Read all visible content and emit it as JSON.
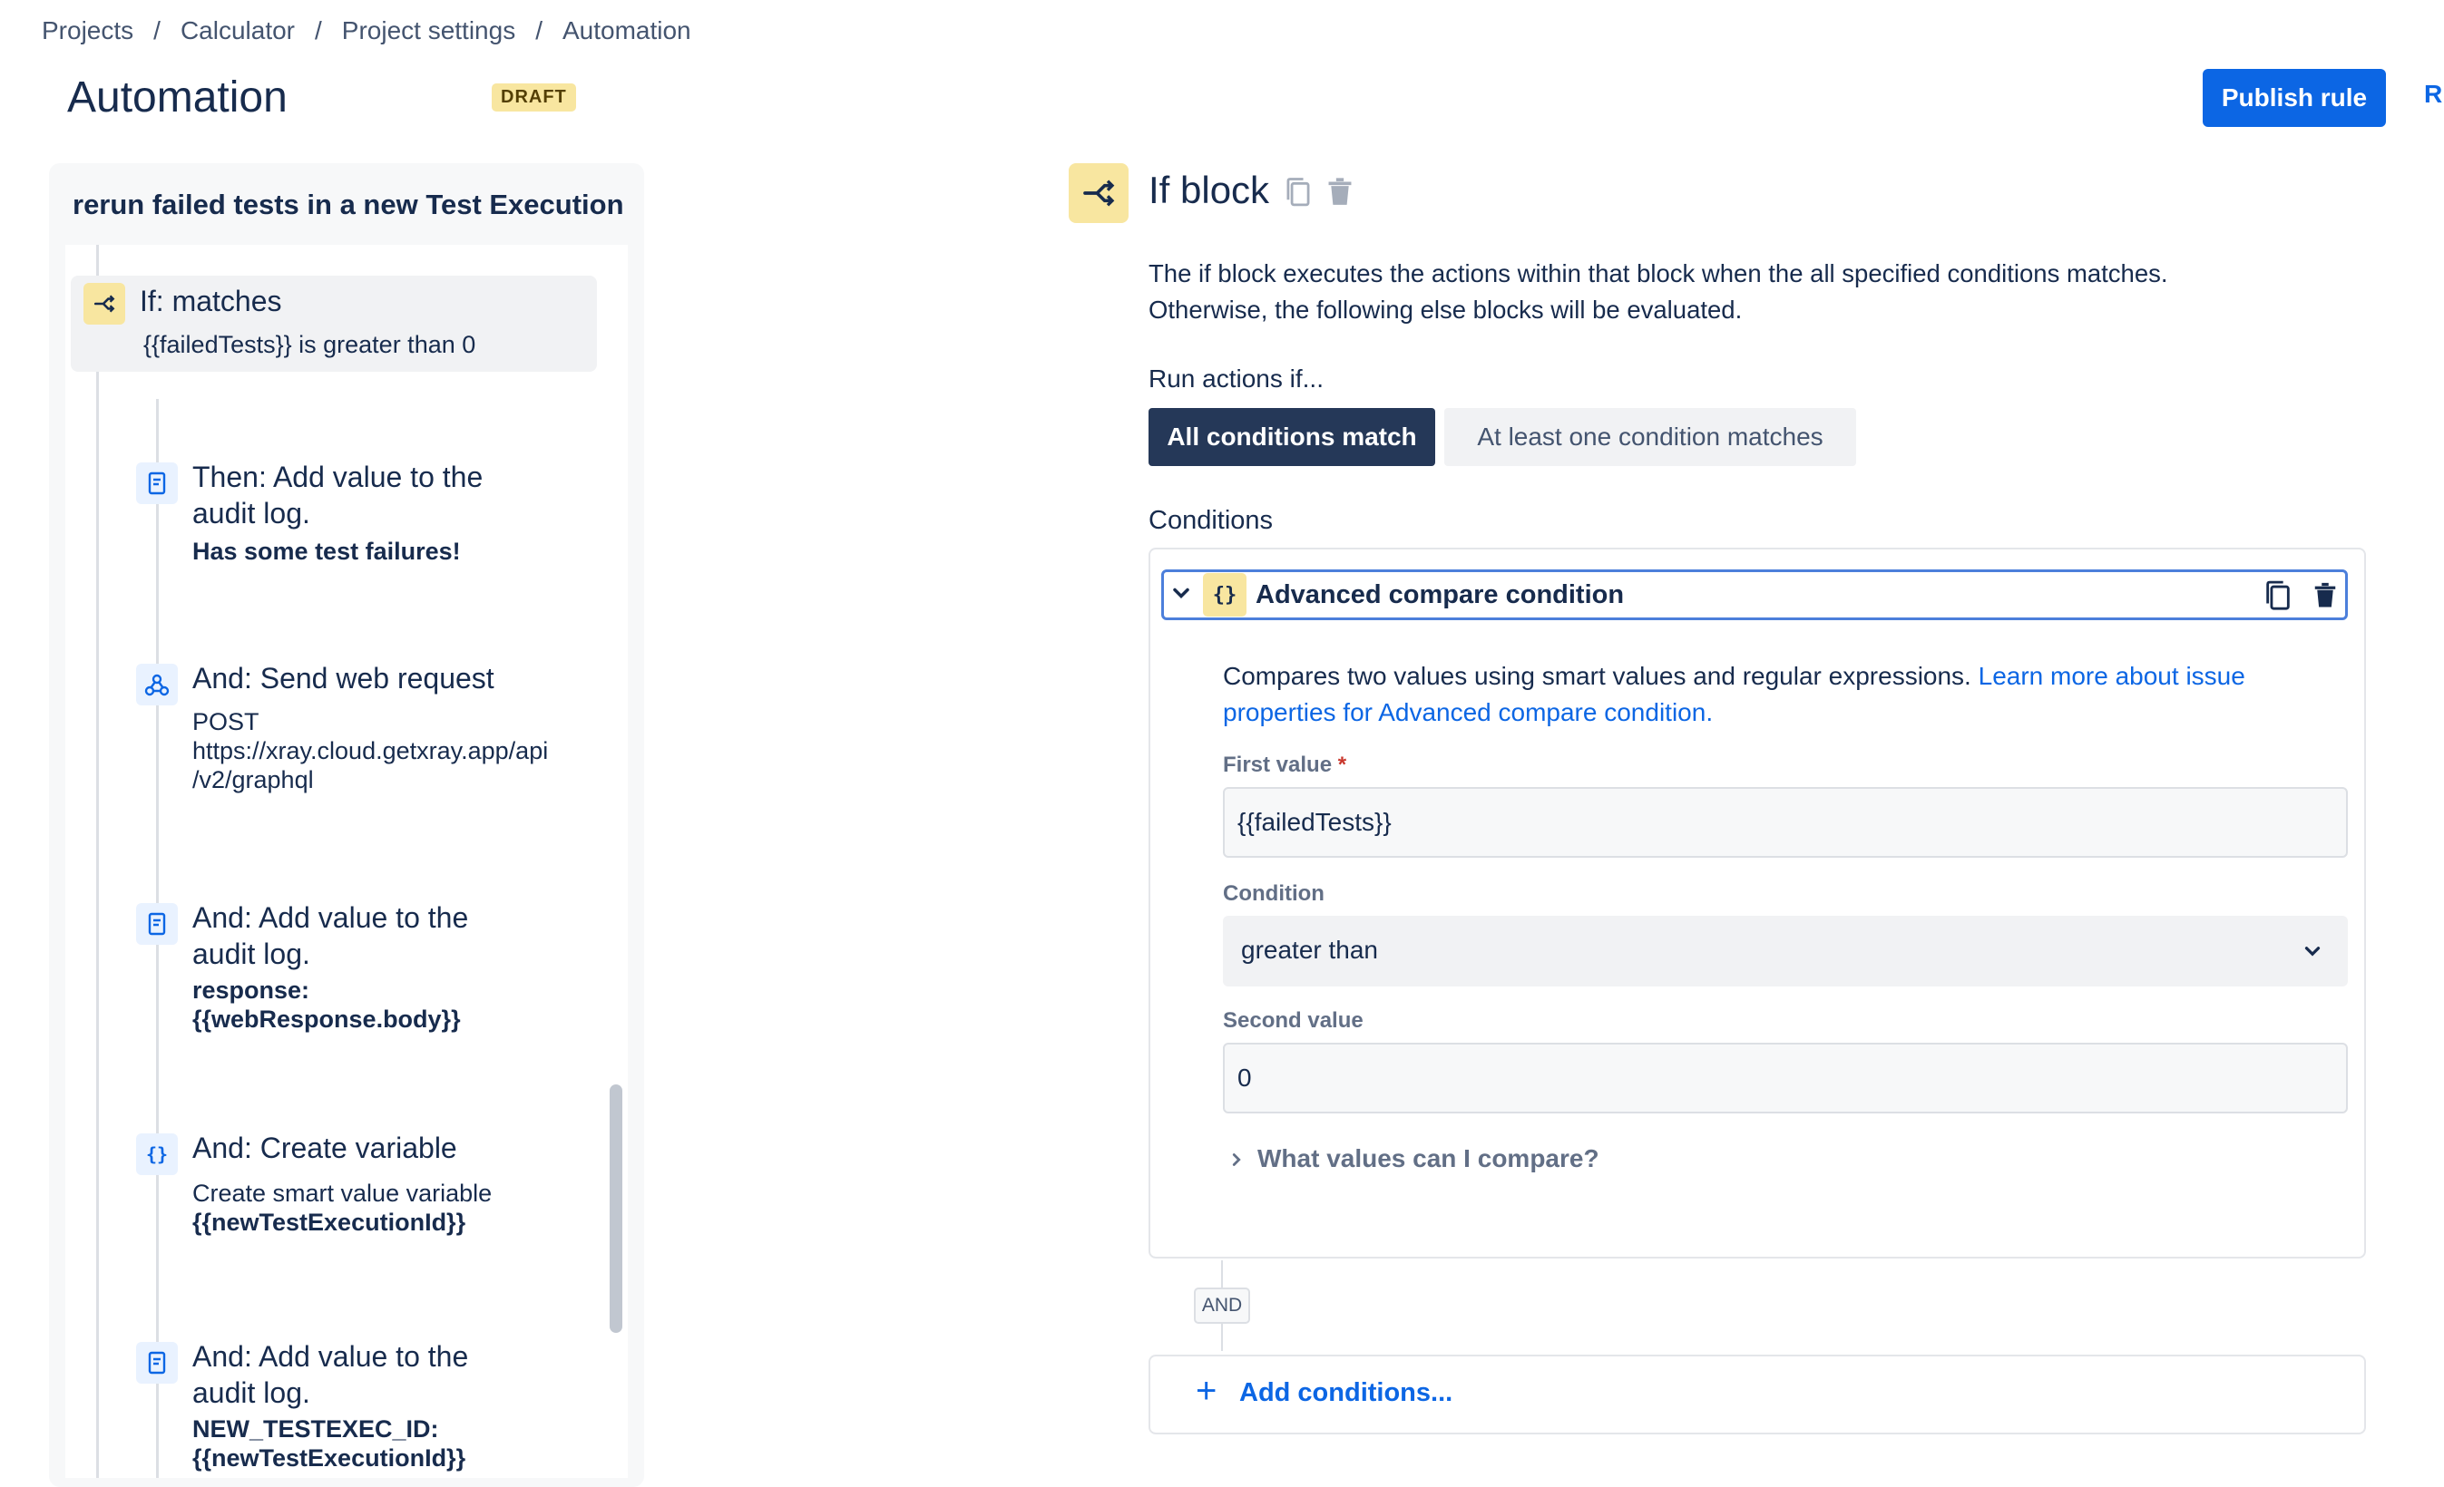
{
  "breadcrumb": [
    "Projects",
    "Calculator",
    "Project settings",
    "Automation"
  ],
  "breadcrumb_sep": "/",
  "header": {
    "title": "Automation",
    "badge": "DRAFT",
    "publish_label": "Publish rule",
    "edge_label": "R"
  },
  "rule": {
    "name": "rerun failed tests in a new Test Execution",
    "if_step": {
      "title": "If: matches",
      "sub": "{{failedTests}} is greater than 0",
      "icon": "branch-icon"
    },
    "steps": [
      {
        "title_lines": [
          "Then: Add value to the",
          "audit log."
        ],
        "bold_lines": [
          "Has some test failures!"
        ],
        "sub_lines": [],
        "icon": "audit-log-icon"
      },
      {
        "title_lines": [
          "And: Send web request"
        ],
        "bold_lines": [],
        "sub_lines": [
          "POST",
          "https://xray.cloud.getxray.app/api",
          "/v2/graphql"
        ],
        "icon": "webhook-icon"
      },
      {
        "title_lines": [
          "And: Add value to the",
          "audit log."
        ],
        "bold_lines": [
          "response:",
          "{{webResponse.body}}"
        ],
        "sub_lines": [],
        "icon": "audit-log-icon"
      },
      {
        "title_lines": [
          "And: Create variable"
        ],
        "bold_lines": [
          "{{newTestExecutionId}}"
        ],
        "sub_lines": [
          "Create smart value variable"
        ],
        "icon": "braces-icon"
      },
      {
        "title_lines": [
          "And: Add value to the",
          "audit log."
        ],
        "bold_lines": [
          "NEW_TESTEXEC_ID:",
          "{{newTestExecutionId}}"
        ],
        "sub_lines": [],
        "icon": "audit-log-icon"
      }
    ]
  },
  "detail": {
    "title": "If block",
    "description_lines": [
      "The if block executes the actions within that block when the all specified conditions matches.",
      "Otherwise, the following else blocks will be evaluated."
    ],
    "run_label": "Run actions if...",
    "run_options": [
      "All conditions match",
      "At least one condition matches"
    ],
    "run_selected": "All conditions match",
    "conditions_label": "Conditions",
    "condition": {
      "title": "Advanced compare condition",
      "icon_glyph": "{}",
      "desc": "Compares two values using smart values and regular expressions. ",
      "link_line1": "Learn more about issue",
      "link_line2": "properties for Advanced compare condition.",
      "first_label": "First value",
      "required_mark": "*",
      "first_value": "{{failedTests}}",
      "condition_label": "Condition",
      "condition_value": "greater than",
      "second_label": "Second value",
      "second_value": "0",
      "help_label": "What values can I compare?"
    },
    "and_label": "AND",
    "add_label": "Add conditions...",
    "add_plus": "+"
  },
  "colors": {
    "primary": "#0C66E4",
    "dark_selected": "#253858",
    "yellow_icon_bg": "#F8E6A0",
    "text": "#172B4D"
  }
}
